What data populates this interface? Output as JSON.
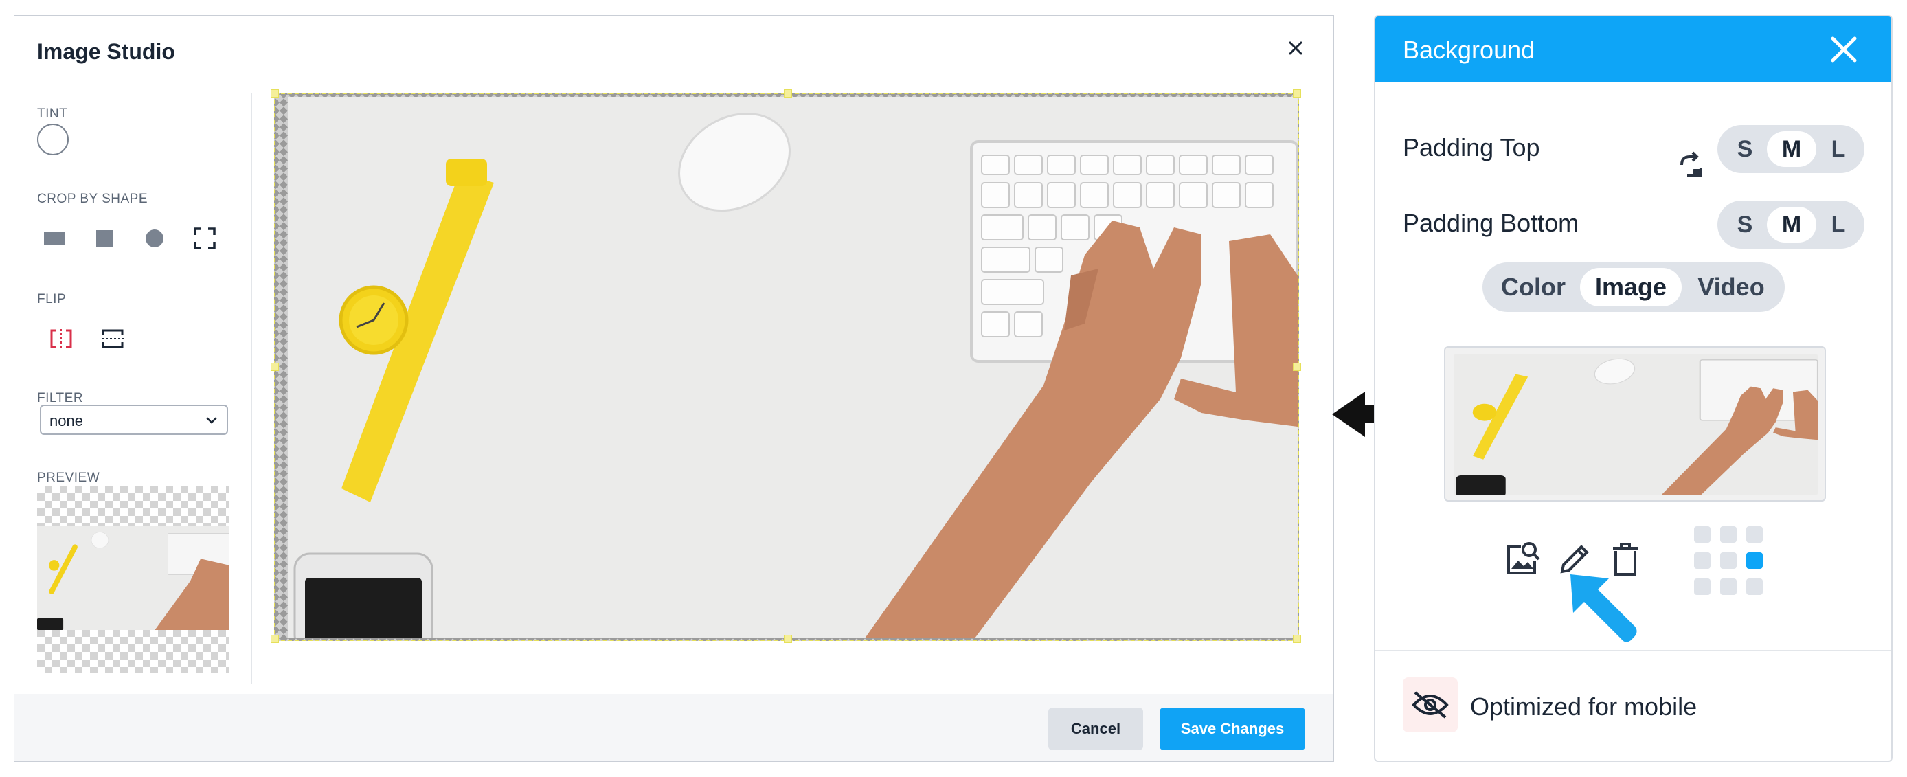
{
  "studio": {
    "title": "Image Studio",
    "tint_label": "TINT",
    "crop_label": "CROP BY SHAPE",
    "flip_label": "FLIP",
    "filter_label": "FILTER",
    "filter_value": "none",
    "preview_label": "PREVIEW",
    "cancel_label": "Cancel",
    "save_label": "Save Changes",
    "crop_shapes": [
      "rectangle-icon",
      "square-icon",
      "circle-icon",
      "freeform-crop-icon"
    ],
    "flip_options": [
      "flip-horizontal-icon",
      "flip-vertical-icon"
    ],
    "accent": "#10a3f5",
    "flip_active_color": "#d9304a"
  },
  "panel": {
    "title": "Background",
    "padding_top_label": "Padding Top",
    "padding_bottom_label": "Padding Bottom",
    "sizes": [
      "S",
      "M",
      "L"
    ],
    "padding_top_selected": "M",
    "padding_bottom_selected": "M",
    "types": [
      "Color",
      "Image",
      "Video"
    ],
    "type_selected": "Image",
    "tools": [
      "image-search-icon",
      "edit-pencil-icon",
      "trash-icon"
    ],
    "position_grid_selected": 5,
    "mobile_label": "Optimized for mobile",
    "header_color": "#0ea5f7"
  }
}
